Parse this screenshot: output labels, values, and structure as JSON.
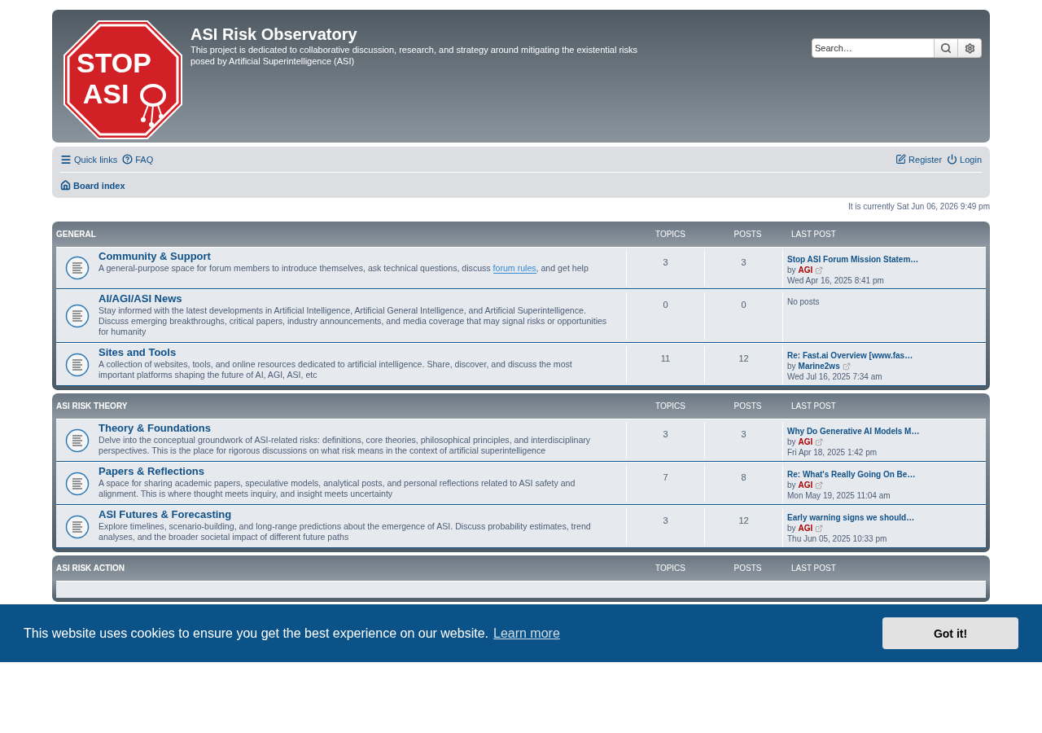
{
  "header": {
    "logo_lines": [
      "STOP",
      "ASI"
    ],
    "title": "ASI Risk Observatory",
    "description": "This project is dedicated to collaborative discussion, research, and strategy around mitigating the existential risks posed by Artificial Superintelligence (ASI)",
    "search": {
      "placeholder": "Search…"
    }
  },
  "nav": {
    "left": [
      "Quick links",
      "FAQ"
    ],
    "right": [
      "Register",
      "Login"
    ],
    "breadcrumb": "Board index"
  },
  "current_time": "It is currently Sat Jun 06, 2026 9:49 pm",
  "categories": [
    {
      "name": "GENERAL",
      "columns": [
        "TOPICS",
        "POSTS",
        "LAST POST"
      ],
      "forums": [
        {
          "title": "Community & Support",
          "description": "A general-purpose space for forum members to introduce themselves, ask technical questions, discuss ",
          "link": "forum rules",
          "description_after": ", and get help",
          "topics": "3",
          "posts": "3",
          "last_post": {
            "kind": "post",
            "title": "Stop ASI Forum Mission Statem…",
            "by": "by",
            "author": "AGI",
            "color": "#aa0000",
            "time": "Wed Apr 16, 2025 8:41 pm"
          }
        },
        {
          "title": "AI/AGI/ASI News",
          "description": "Stay informed with the latest developments in Artificial Intelligence, Artificial General Intelligence, and Artificial Superintelligence. Discuss emerging breakthroughs, critical papers, industry announcements, and media coverage that may signal risks or opportunities for humanity",
          "topics": "0",
          "posts": "0",
          "last_post": {
            "kind": "empty",
            "text": "No posts"
          }
        },
        {
          "title": "Sites and Tools",
          "description": "A collection of websites, tools, and online resources dedicated to artificial intelligence. Share, discover, and discuss the most important platforms shaping the future of AI, AGI, ASI, etc",
          "topics": "11",
          "posts": "12",
          "last_post": {
            "kind": "post",
            "title": "Re: Fast.ai Overview [www.fas…",
            "by": "by",
            "author": "Marine2ws",
            "color": "#105289",
            "time": "Wed Jul 16, 2025 7:34 am"
          }
        }
      ]
    },
    {
      "name": "ASI RISK THEORY",
      "columns": [
        "TOPICS",
        "POSTS",
        "LAST POST"
      ],
      "forums": [
        {
          "title": "Theory & Foundations",
          "description": "Delve into the conceptual groundwork of ASI-related risks: definitions, core theories, philosophical principles, and interdisciplinary perspectives. This is the place for rigorous discussions on what risk means in the context of artificial superintelligence",
          "topics": "3",
          "posts": "3",
          "last_post": {
            "kind": "post",
            "title": "Why Do Generative AI Models M…",
            "by": "by",
            "author": "AGI",
            "color": "#aa0000",
            "time": "Fri Apr 18, 2025 1:42 pm"
          }
        },
        {
          "title": "Papers & Reflections",
          "description": "A space for sharing academic papers, speculative models, analytical posts, and personal reflections related to ASI safety and alignment. This is where thought meets inquiry, and insight meets uncertainty",
          "topics": "7",
          "posts": "8",
          "last_post": {
            "kind": "post",
            "title": "Re: What's Really Going On Be…",
            "by": "by",
            "author": "AGI",
            "color": "#aa0000",
            "time": "Mon May 19, 2025 11:04 am"
          }
        },
        {
          "title": "ASI Futures & Forecasting",
          "description": "Explore timelines, scenario-building, and long-range predictions about the emergence of ASI. Discuss probability estimates, trend analyses, and the broader societal impact of different future paths",
          "topics": "3",
          "posts": "12",
          "last_post": {
            "kind": "post",
            "title": "Early warning signs we should…",
            "by": "by",
            "author": "AGI",
            "color": "#aa0000",
            "time": "Thu Jun 05, 2025 10:33 pm"
          }
        }
      ]
    },
    {
      "name": "ASI RISK ACTION",
      "columns": [
        "TOPICS",
        "POSTS",
        "LAST POST"
      ]
    }
  ],
  "cookie_banner": {
    "message": "This website uses cookies to ensure you get the best experience on our website.",
    "link": "Learn more",
    "button": "Got it!"
  }
}
